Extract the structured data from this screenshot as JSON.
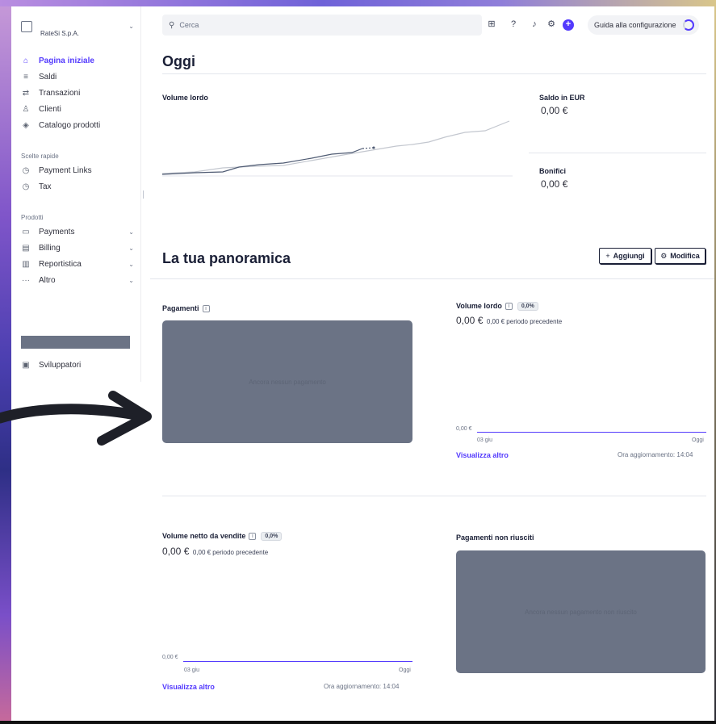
{
  "account": {
    "name": "RateSi S.p.A."
  },
  "sidebar": {
    "main": [
      {
        "label": "Pagina iniziale",
        "icon": "home-icon",
        "glyph": "⌂",
        "active": true
      },
      {
        "label": "Saldi",
        "icon": "balance-icon",
        "glyph": "≡"
      },
      {
        "label": "Transazioni",
        "icon": "transactions-icon",
        "glyph": "⇄"
      },
      {
        "label": "Clienti",
        "icon": "customers-icon",
        "glyph": "♙"
      },
      {
        "label": "Catalogo prodotti",
        "icon": "product-catalog-icon",
        "glyph": "◈"
      }
    ],
    "shortcuts_title": "Scelte rapide",
    "shortcuts": [
      {
        "label": "Payment Links",
        "icon": "clock-icon",
        "glyph": "◷"
      },
      {
        "label": "Tax",
        "icon": "clock-icon",
        "glyph": "◷"
      }
    ],
    "products_title": "Prodotti",
    "products": [
      {
        "label": "Payments",
        "icon": "payments-icon",
        "glyph": "▭"
      },
      {
        "label": "Billing",
        "icon": "billing-icon",
        "glyph": "▤"
      },
      {
        "label": "Reportistica",
        "icon": "reports-icon",
        "glyph": "▥"
      },
      {
        "label": "Altro",
        "icon": "more-icon",
        "glyph": "···"
      }
    ],
    "developers": {
      "label": "Sviluppatori",
      "icon": "terminal-icon"
    }
  },
  "topbar": {
    "search_placeholder": "Cerca",
    "guide_label": "Guida alla configurazione"
  },
  "today": {
    "title": "Oggi",
    "gross_volume_label": "Volume lordo",
    "balance_label": "Saldo in EUR",
    "balance_value": "0,00 €",
    "payouts_label": "Bonifici",
    "payouts_value": "0,00 €"
  },
  "overview": {
    "title": "La tua panoramica",
    "add_label": "Aggiungi",
    "edit_label": "Modifica"
  },
  "widgets": {
    "payments": {
      "title": "Pagamenti",
      "empty": "Ancora nessun pagamento"
    },
    "gross_volume": {
      "title": "Volume lordo",
      "change": "0,0%",
      "value": "0,00 €",
      "previous": "0,00 € periodo precedente",
      "axis_y": "0,00 €",
      "x_start": "03 giu",
      "x_end": "Oggi",
      "link": "Visualizza altro",
      "updated": "Ora aggiornamento: 14:04"
    },
    "net_volume": {
      "title": "Volume netto da vendite",
      "change": "0,0%",
      "value": "0,00 €",
      "previous": "0,00 € periodo precedente",
      "axis_y": "0,00 €",
      "x_start": "03 giu",
      "x_end": "Oggi",
      "link": "Visualizza altro",
      "updated": "Ora aggiornamento: 14:04"
    },
    "failed_payments": {
      "title": "Pagamenti non riusciti",
      "empty": "Ancora nessun pagamento non riuscito"
    }
  },
  "colors": {
    "accent": "#533afd",
    "placeholder": "#6b7385"
  }
}
